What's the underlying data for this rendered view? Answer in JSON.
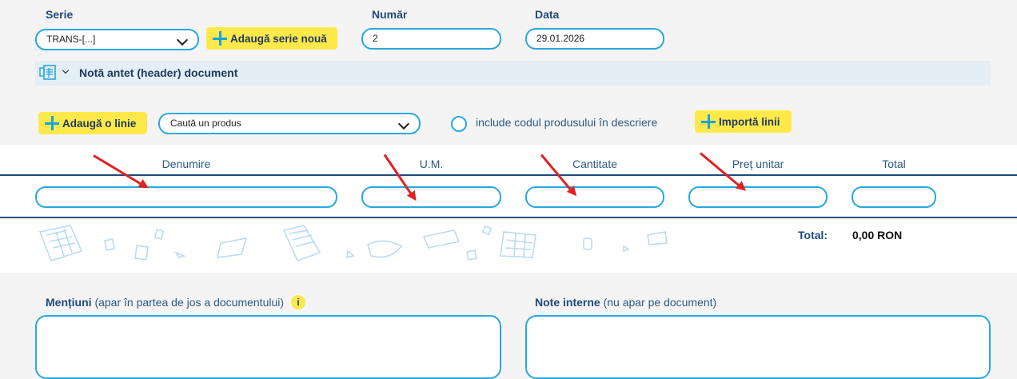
{
  "header": {
    "serie_label": "Serie",
    "serie_value": "TRANS-[...]",
    "add_serie_label": "Adaugă serie nouă",
    "numar_label": "Număr",
    "numar_value": "2",
    "data_label": "Data",
    "data_value": "29.01.2026"
  },
  "note_section": {
    "label": "Notă antet (header) document",
    "icon": "document-note-icon"
  },
  "toolbar": {
    "add_line_label": "Adaugă o linie",
    "product_search_placeholder": "Caută un produs",
    "include_code_label": "include codul produsului în descriere",
    "import_label": "Importă linii"
  },
  "table": {
    "columns": [
      "Denumire",
      "U.M.",
      "Cantitate",
      "Preț unitar",
      "Total"
    ],
    "total_label": "Total:",
    "total_value": "0,00 RON"
  },
  "bottom": {
    "mentiuni_title": "Mențiuni",
    "mentiuni_sub": "(apar în partea de jos a documentului)",
    "info_icon": "i",
    "note_interne_title": "Note interne",
    "note_interne_sub": "(nu apar pe document)"
  },
  "colors": {
    "accent": "#29a8e0",
    "button_yellow": "#ffe94a",
    "label_blue": "#1e4a7c",
    "annotation_red": "#e02222"
  }
}
